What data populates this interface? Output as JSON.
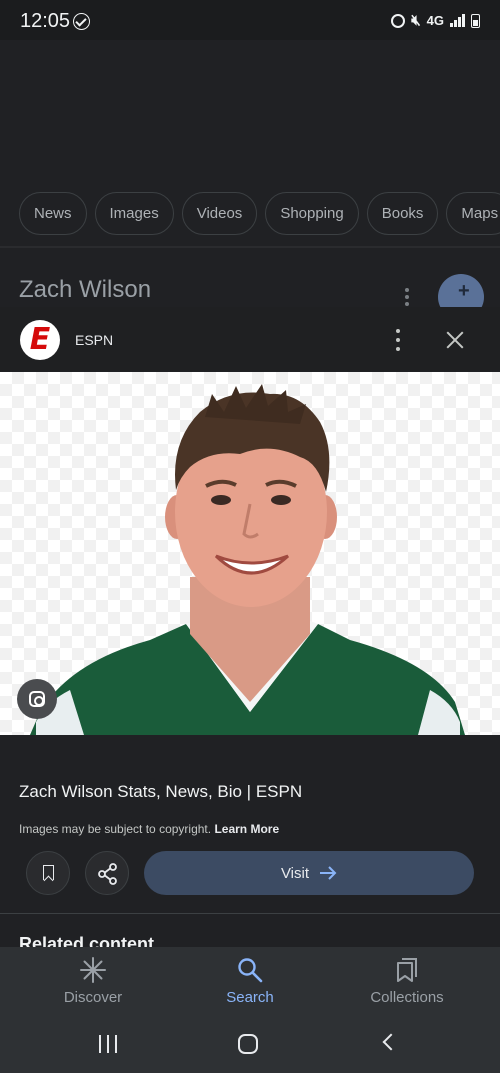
{
  "status_bar": {
    "time": "12:05",
    "network": "4G"
  },
  "background_page": {
    "chips": [
      "News",
      "Images",
      "Videos",
      "Shopping",
      "Books",
      "Maps"
    ],
    "title": "Zach Wilson"
  },
  "viewer": {
    "source_name": "ESPN",
    "source_logo_letter": "E",
    "source_logo_color": "#d50a0a",
    "image_alt": "Zach Wilson headshot",
    "result_title": "Zach Wilson Stats, News, Bio | ESPN",
    "copyright_text": "Images may be subject to copyright.",
    "learn_more": "Learn More",
    "visit_label": "Visit",
    "related_heading": "Related content"
  },
  "bottom_nav": {
    "items": [
      {
        "label": "Discover",
        "icon": "asterisk-icon"
      },
      {
        "label": "Search",
        "icon": "search-icon",
        "active": true
      },
      {
        "label": "Collections",
        "icon": "collections-icon"
      }
    ]
  },
  "colors": {
    "background": "#202124",
    "accent": "#8ab4f8",
    "visit_button": "#3c4b63",
    "jersey_green": "#1a5c3a"
  }
}
